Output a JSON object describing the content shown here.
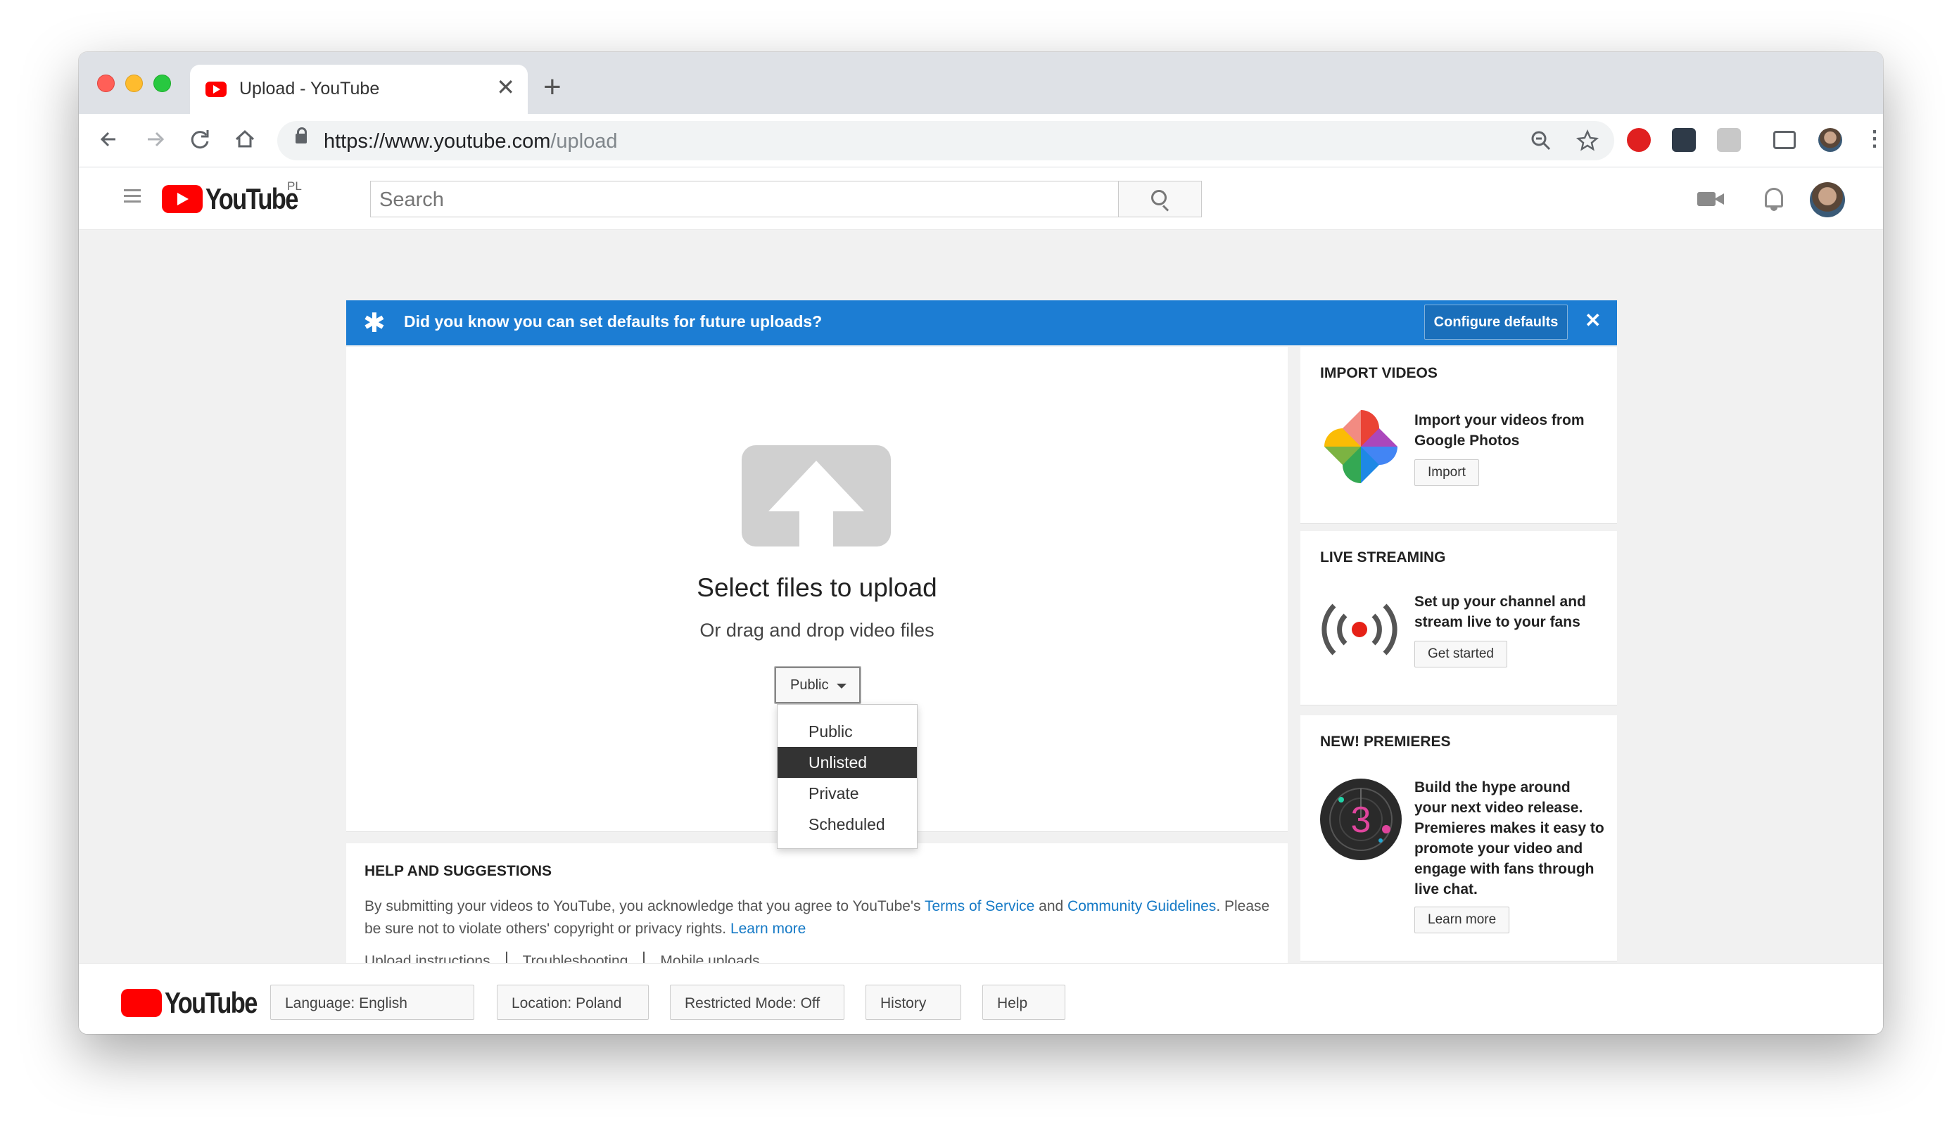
{
  "browser": {
    "tab_title": "Upload - YouTube",
    "tab_close": "✕",
    "new_tab": "+",
    "url_host": "https://www.youtube.com",
    "url_path": "/upload"
  },
  "header": {
    "logo_text": "YouTube",
    "logo_region": "PL",
    "search_placeholder": "Search"
  },
  "banner": {
    "icon": "✱",
    "text": "Did you know you can set defaults for future uploads?",
    "configure_label": "Configure defaults",
    "close": "✕"
  },
  "upload": {
    "title": "Select files to upload",
    "subtitle": "Or drag and drop video files",
    "privacy_selected": "Public",
    "privacy_options": [
      "Public",
      "Unlisted",
      "Private",
      "Scheduled"
    ],
    "highlighted_option": "Unlisted"
  },
  "help": {
    "title": "HELP AND SUGGESTIONS",
    "text_before": "By submitting your videos to YouTube, you acknowledge that you agree to YouTube's ",
    "tos_link": "Terms of Service",
    "and": " and ",
    "guidelines_link": "Community Guidelines",
    "text_after": ". Please be sure not to violate others' copyright or privacy rights. ",
    "learn_more": "Learn more",
    "links": [
      "Upload instructions",
      "Troubleshooting",
      "Mobile uploads"
    ]
  },
  "side": {
    "import": {
      "title": "IMPORT VIDEOS",
      "desc": "Import your videos from Google Photos",
      "button": "Import"
    },
    "live": {
      "title": "LIVE STREAMING",
      "desc": "Set up your channel and stream live to your fans",
      "button": "Get started"
    },
    "premieres": {
      "title": "NEW! PREMIERES",
      "desc": "Build the hype around your next video release. Premieres makes it easy to promote your video and engage with fans through live chat.",
      "button": "Learn more",
      "icon_number": "3"
    }
  },
  "footer": {
    "logo_text": "YouTube",
    "buttons": [
      "Language: English",
      "Location: Poland",
      "Restricted Mode: Off",
      "History",
      "Help"
    ]
  },
  "colors": {
    "banner": "#1c7dd3",
    "youtube_red": "#ff0000",
    "link": "#167ac6"
  }
}
